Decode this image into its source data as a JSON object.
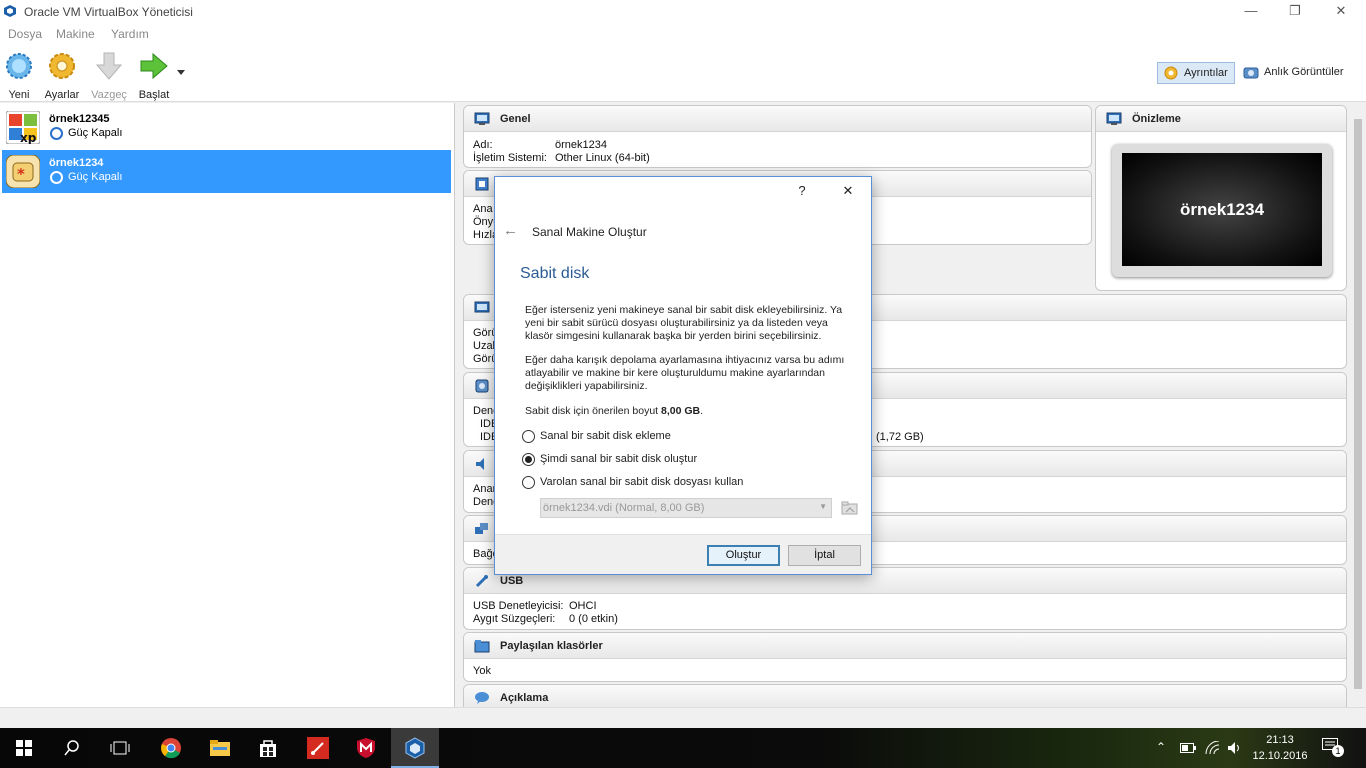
{
  "window": {
    "title": "Oracle VM VirtualBox Yöneticisi",
    "minimize": "—",
    "maximize": "❐",
    "close": "✕"
  },
  "menu": [
    "Dosya",
    "Makine",
    "Yardım"
  ],
  "toolbar": {
    "new": "Yeni",
    "settings": "Ayarlar",
    "discard": "Vazgeç",
    "start": "Başlat",
    "details": "Ayrıntılar",
    "snapshots": "Anlık Görüntüler"
  },
  "vms": [
    {
      "name": "örnek12345",
      "state": "Güç Kapalı",
      "os": "xp"
    },
    {
      "name": "örnek1234",
      "state": "Güç Kapalı",
      "os": "linux"
    }
  ],
  "details": {
    "general": {
      "title": "Genel",
      "name_label": "Adı:",
      "name_value": "örnek1234",
      "os_label": "İşletim Sistemi:",
      "os_value": "Other Linux (64-bit)"
    },
    "system": {
      "rows": [
        "Ana",
        "Önyü",
        "Hızla"
      ]
    },
    "display": {
      "rows": [
        "Görü",
        "Uzak",
        "Görü"
      ]
    },
    "storage": {
      "rows": [
        "Dene",
        "IDE",
        "IDE"
      ],
      "size_fragment": "1,72 GB)"
    },
    "audio": {
      "rows": [
        "Anam",
        "Dene"
      ]
    },
    "network": {
      "rows": [
        "Bağd"
      ]
    },
    "usb": {
      "title": "USB",
      "controller_label": "USB Denetleyicisi:",
      "controller_value": "OHCI",
      "filters_label": "Aygıt Süzgeçleri:",
      "filters_value": "0 (0 etkin)"
    },
    "shared": {
      "title": "Paylaşılan klasörler",
      "value": "Yok"
    },
    "description": {
      "title": "Açıklama"
    },
    "preview": {
      "title": "Önizleme",
      "screen_text": "örnek1234"
    }
  },
  "dialog": {
    "help": "?",
    "close": "✕",
    "back": "←",
    "title": "Sanal Makine Oluştur",
    "heading": "Sabit disk",
    "para1": "Eğer isterseniz yeni makineye sanal bir sabit disk ekleyebilirsiniz. Ya yeni bir sabit sürücü dosyası oluşturabilirsiniz ya da listeden veya klasör simgesini kullanarak başka bir yerden birini seçebilirsiniz.",
    "para2": "Eğer daha karışık depolama ayarlamasına ihtiyacınız varsa bu adımı atlayabilir ve makine bir kere oluşturuldumu makine ayarlarından değişiklikleri yapabilirsiniz.",
    "recommended_prefix": "Sabit disk için önerilen boyut ",
    "recommended_size": "8,00 GB",
    "recommended_suffix": ".",
    "options": [
      {
        "label": "Sanal bir sabit disk ekleme",
        "selected": false
      },
      {
        "label": "Şimdi sanal bir sabit disk oluştur",
        "selected": true
      },
      {
        "label": "Varolan sanal bir sabit disk dosyası kullan",
        "selected": false
      }
    ],
    "existing_file": "örnek1234.vdi (Normal, 8,00 GB)",
    "create_button": "Oluştur",
    "cancel_button": "İptal"
  },
  "taskbar": {
    "time": "21:13",
    "date": "12.10.2016",
    "notifications": "1"
  }
}
